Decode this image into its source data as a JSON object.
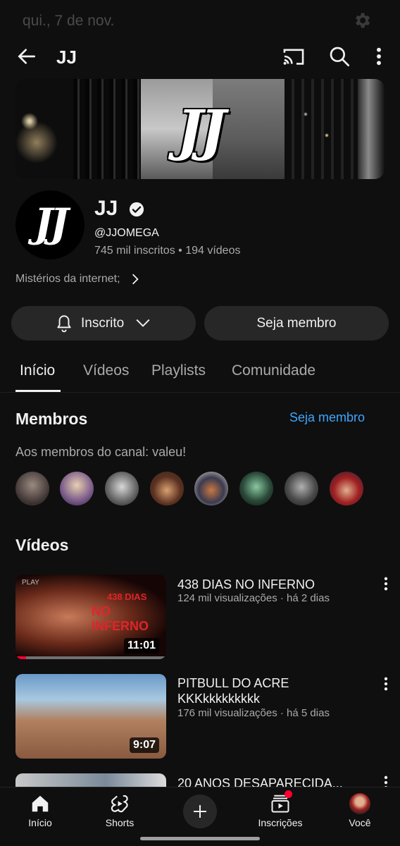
{
  "status": {
    "date": "qui., 7 de nov."
  },
  "appbar": {
    "title": "JJ"
  },
  "banner": {
    "logo_text": "JJ"
  },
  "channel": {
    "logo_text": "JJ",
    "name": "JJ",
    "handle": "@JJOMEGA",
    "stats": "745 mil inscritos • 194 vídeos",
    "description": "Mistérios da internet;"
  },
  "actions": {
    "subscribed_label": "Inscrito",
    "member_label": "Seja membro"
  },
  "tabs": [
    {
      "label": "Início",
      "active": true
    },
    {
      "label": "Vídeos",
      "active": false
    },
    {
      "label": "Playlists",
      "active": false
    },
    {
      "label": "Comunidade",
      "active": false
    }
  ],
  "members": {
    "title": "Membros",
    "join_link": "Seja membro",
    "thanks": "Aos membros do canal: valeu!",
    "avatar_count": 8
  },
  "videos": {
    "title": "Vídeos",
    "items": [
      {
        "title": "438 DIAS NO INFERNO",
        "meta": "124 mil visualizações · há 2 dias",
        "duration": "11:01",
        "thumb_text_top": "438 DIAS",
        "thumb_text_bottom": "NO INFERNO",
        "thumb_tag": "PLAY",
        "progress": 0.07
      },
      {
        "title": "PITBULL DO ACRE KKKkkkkkkkkk",
        "meta": "176 mil visualizações · há 5 dias",
        "duration": "9:07"
      },
      {
        "title": "20 ANOS DESAPARECIDA..."
      }
    ]
  },
  "bottom_nav": [
    {
      "label": "Início",
      "icon": "home-icon"
    },
    {
      "label": "Shorts",
      "icon": "shorts-icon"
    },
    {
      "label": "",
      "icon": "create-plus-icon"
    },
    {
      "label": "Inscrições",
      "icon": "subscriptions-icon"
    },
    {
      "label": "Você",
      "icon": "you-avatar-icon"
    }
  ],
  "colors": {
    "background": "#0f0f0f",
    "link": "#3ea6ff",
    "button": "#272727",
    "notification": "#ff0033",
    "thumb_red_text": "#e0242a"
  }
}
